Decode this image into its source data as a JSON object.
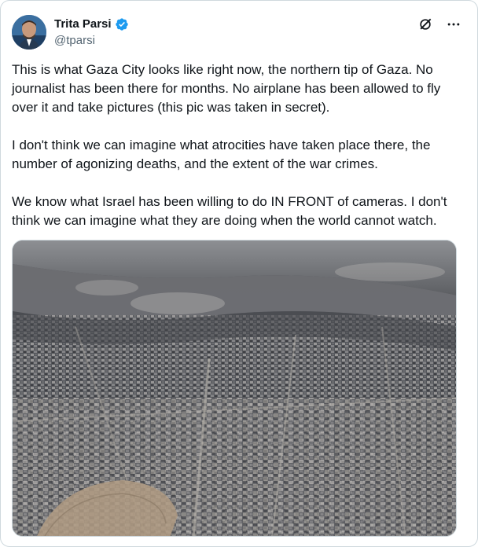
{
  "author": {
    "display_name": "Trita Parsi",
    "handle": "@tparsi",
    "verified": true,
    "avatar_icon": "user-avatar"
  },
  "header_icons": [
    "grok-icon",
    "more-icon"
  ],
  "tweet": {
    "paragraphs": [
      "This is what Gaza City looks like right now, the northern tip of Gaza. No journalist has been there for months. No airplane has been allowed to fly over it and take pictures (this pic was taken in secret).",
      "I don't think we can imagine what atrocities have taken place there, the number of agonizing deaths, and the extent of the war crimes.",
      "We know what Israel has been willing to do IN FRONT of cameras. I don't think we can imagine what they are doing when the world cannot watch."
    ]
  },
  "colors": {
    "text": "#0f1419",
    "secondary": "#536471",
    "verified_badge": "#1d9bf0",
    "border": "#cfd9de"
  }
}
